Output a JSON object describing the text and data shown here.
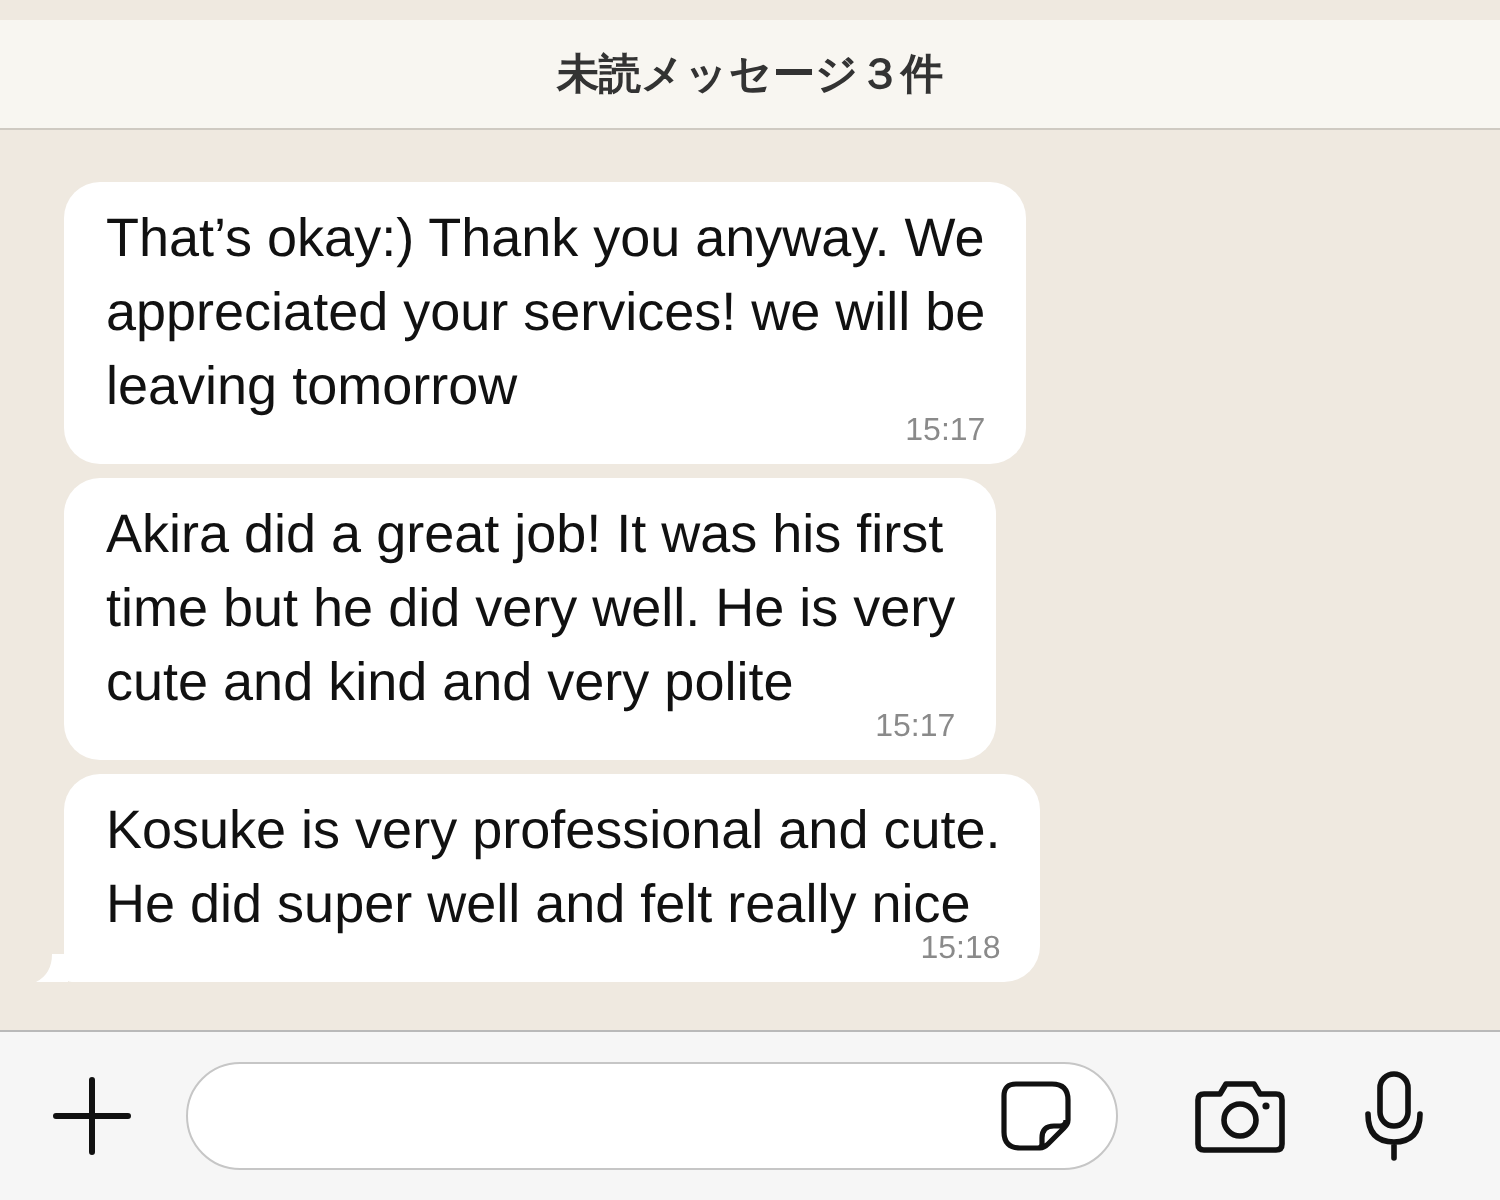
{
  "banner": {
    "text": "未読メッセージ３件"
  },
  "messages": [
    {
      "text": "That’s okay:) Thank you anyway. We\nappreciated your services! we will be\nleaving tomorrow",
      "time": "15:17",
      "tail": false
    },
    {
      "text": "Akira did a great job! It was his first\ntime but he did very well. He is very\ncute and kind and very polite",
      "time": "15:17",
      "tail": false
    },
    {
      "text": "Kosuke is very professional and cute.\nHe did super well and felt really nice",
      "time": "15:18",
      "tail": true
    }
  ]
}
